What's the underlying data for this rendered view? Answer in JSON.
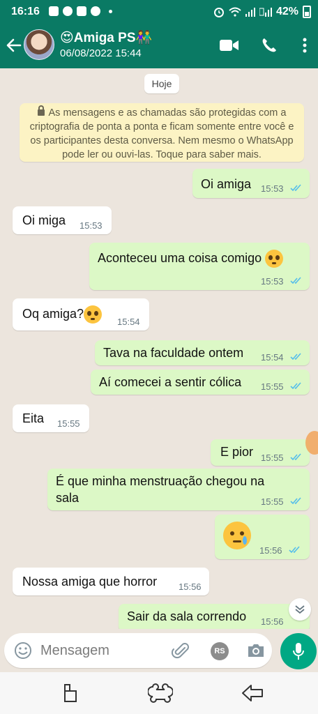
{
  "status_bar": {
    "time": "16:16",
    "battery": "42%"
  },
  "header": {
    "title": "😍Amiga PS👫",
    "subtitle": "06/08/2022 15:44"
  },
  "chat": {
    "day_chip": "Hoje",
    "encryption_notice": "As mensagens e as chamadas são protegidas com a criptografia de ponta a ponta e ficam somente entre você e os participantes desta conversa. Nem mesmo o WhatsApp pode ler ou ouvi-las. Toque para saber mais.",
    "messages": [
      {
        "dir": "out",
        "text": "Oi amiga",
        "time": "15:53"
      },
      {
        "dir": "in",
        "text": "Oi miga",
        "time": "15:53"
      },
      {
        "dir": "out",
        "text": "Aconteceu uma coisa comigo",
        "time": "15:53",
        "emoji": "flushed-face"
      },
      {
        "dir": "in",
        "text": "Oq amiga?",
        "time": "15:54",
        "emoji": "flushed-face"
      },
      {
        "dir": "out",
        "text": "Tava na faculdade ontem",
        "time": "15:54"
      },
      {
        "dir": "out",
        "text": "Aí comecei a sentir cólica",
        "time": "15:55"
      },
      {
        "dir": "in",
        "text": "Eita",
        "time": "15:55"
      },
      {
        "dir": "out",
        "text": "E pior",
        "time": "15:55"
      },
      {
        "dir": "out",
        "text_line1": "É que minha menstruação chegou na",
        "text_line2": "sala",
        "time": "15:55"
      },
      {
        "dir": "out",
        "text": "",
        "time": "15:56",
        "emoji": "crying-face"
      },
      {
        "dir": "in",
        "text": "Nossa amiga que horror",
        "time": "15:56"
      },
      {
        "dir": "out",
        "text": "Sair da sala correndo",
        "time": "15:56"
      }
    ]
  },
  "input": {
    "placeholder": "Mensagem",
    "rs_label": "RS"
  },
  "colors": {
    "header": "#0a7a64",
    "outgoing": "#dcf8c6",
    "incoming": "#ffffff",
    "chat_bg": "#ece5dd",
    "mic": "#00a884",
    "tick": "#53bdeb"
  },
  "icons": [
    "back-arrow-icon",
    "video-call-icon",
    "phone-icon",
    "more-vert-icon",
    "lock-icon",
    "read-ticks-icon",
    "chevron-down-icon",
    "emoji-icon",
    "paperclip-icon",
    "camera-icon",
    "mic-icon",
    "recent-apps-icon",
    "home-icon",
    "back-nav-icon"
  ]
}
